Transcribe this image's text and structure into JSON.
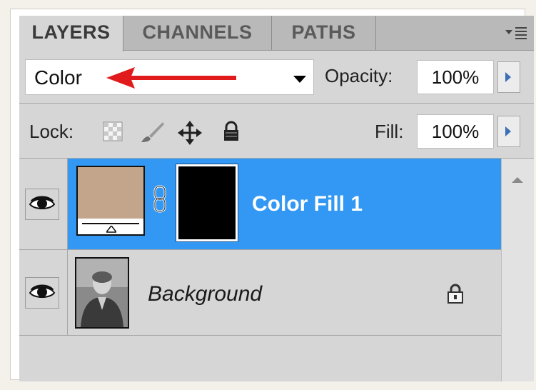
{
  "tabs": [
    {
      "label": "LAYERS",
      "active": true
    },
    {
      "label": "CHANNELS",
      "active": false
    },
    {
      "label": "PATHS",
      "active": false
    }
  ],
  "blend_mode": {
    "value": "Color"
  },
  "opacity": {
    "label": "Opacity:",
    "value": "100%"
  },
  "lock": {
    "label": "Lock:"
  },
  "fill": {
    "label": "Fill:",
    "value": "100%"
  },
  "layers": [
    {
      "name": "Color Fill 1",
      "selected": true,
      "visible": true,
      "fill_color": "#c3a58b"
    },
    {
      "name": "Background",
      "selected": false,
      "visible": true,
      "locked": true
    }
  ],
  "colors": {
    "selection": "#3398f3",
    "panel_bg": "#d6d6d6",
    "tab_bar": "#b9b9b9",
    "annotation_arrow": "#e11b1b"
  },
  "icons": [
    "panel-menu-icon",
    "dropdown-caret-icon",
    "stepper-arrow-icon",
    "lock-transparent-icon",
    "lock-brush-icon",
    "lock-move-icon",
    "lock-all-icon",
    "eye-icon",
    "link-icon",
    "padlock-icon",
    "scroll-up-icon"
  ]
}
